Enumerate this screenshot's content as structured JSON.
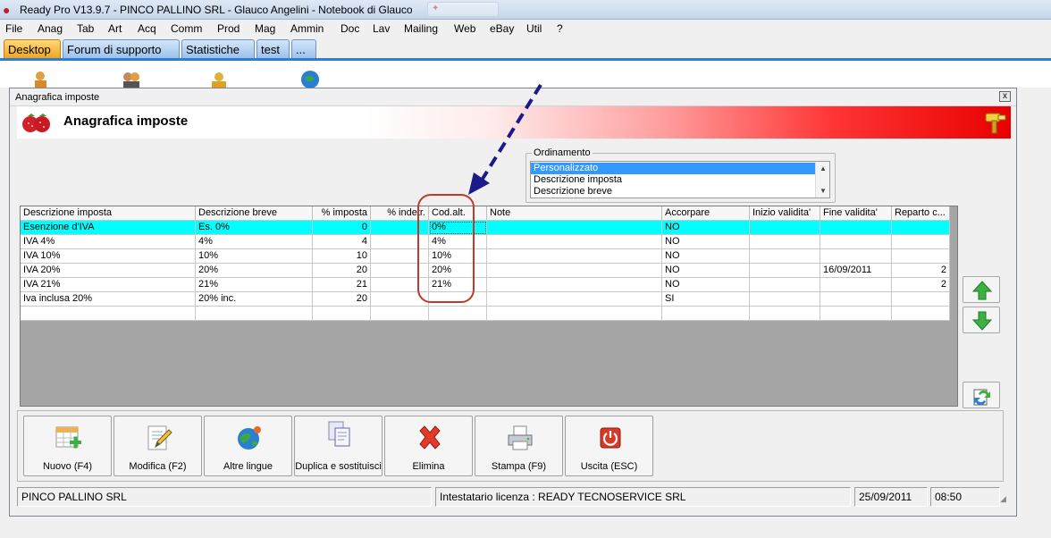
{
  "window_title": "Ready Pro V13.9.7 - PINCO PALLINO SRL - Glauco Angelini - Notebook di Glauco",
  "menu": [
    "File",
    "Anag",
    "Tab",
    "Art",
    "Acq",
    "Comm",
    "Prod",
    "Mag",
    "Ammin",
    "Doc",
    "Lav",
    "Mailing",
    "Web",
    "eBay",
    "Util",
    "?"
  ],
  "tabs": [
    "Desktop",
    "Forum di supporto",
    "Statistiche",
    "test",
    "..."
  ],
  "dialog": {
    "caption": "Anagrafica imposte",
    "heading": "Anagrafica imposte",
    "close_glyph": "x"
  },
  "ordinamento": {
    "label": "Ordinamento",
    "options": [
      "Personalizzato",
      "Descrizione imposta",
      "Descrizione breve"
    ],
    "selected": "Personalizzato"
  },
  "table": {
    "columns": [
      "Descrizione imposta",
      "Descrizione breve",
      "% imposta",
      "% indetr.",
      "Cod.alt.",
      "Note",
      "Accorpare",
      "Inizio validita'",
      "Fine validita'",
      "Reparto c..."
    ],
    "rows": [
      {
        "descrizione": "Esenzione d'IVA",
        "breve": "Es. 0%",
        "imposta": "0",
        "indetr": "",
        "codalt": "0%",
        "note": "",
        "accorpare": "NO",
        "inizio": "",
        "fine": "",
        "reparto": ""
      },
      {
        "descrizione": "IVA 4%",
        "breve": "4%",
        "imposta": "4",
        "indetr": "",
        "codalt": "4%",
        "note": "",
        "accorpare": "NO",
        "inizio": "",
        "fine": "",
        "reparto": ""
      },
      {
        "descrizione": "IVA 10%",
        "breve": "10%",
        "imposta": "10",
        "indetr": "",
        "codalt": "10%",
        "note": "",
        "accorpare": "NO",
        "inizio": "",
        "fine": "",
        "reparto": ""
      },
      {
        "descrizione": "IVA 20%",
        "breve": "20%",
        "imposta": "20",
        "indetr": "",
        "codalt": "20%",
        "note": "",
        "accorpare": "NO",
        "inizio": "",
        "fine": "16/09/2011",
        "reparto": "2"
      },
      {
        "descrizione": "IVA 21%",
        "breve": "21%",
        "imposta": "21",
        "indetr": "",
        "codalt": "21%",
        "note": "",
        "accorpare": "NO",
        "inizio": "",
        "fine": "",
        "reparto": "2"
      },
      {
        "descrizione": "Iva inclusa 20%",
        "breve": "20% inc.",
        "imposta": "20",
        "indetr": "",
        "codalt": "",
        "note": "",
        "accorpare": "SI",
        "inizio": "",
        "fine": "",
        "reparto": ""
      }
    ]
  },
  "toolbar": [
    {
      "label": "Nuovo (F4)",
      "icon": "new-grid-icon"
    },
    {
      "label": "Modifica (F2)",
      "icon": "edit-pencil-icon"
    },
    {
      "label": "Altre lingue",
      "icon": "globe-icon"
    },
    {
      "label": "Duplica e sostituisci",
      "icon": "duplicate-icon"
    },
    {
      "label": "Elimina",
      "icon": "delete-x-icon"
    },
    {
      "label": "Stampa (F9)",
      "icon": "printer-icon"
    },
    {
      "label": "Uscita (ESC)",
      "icon": "power-icon"
    }
  ],
  "side_buttons": [
    "arrow-up-icon",
    "arrow-down-icon",
    "refresh-icon"
  ],
  "status": {
    "company": "PINCO PALLINO SRL",
    "license": "Intestatario licenza : READY TECNOSERVICE SRL",
    "date": "25/09/2011",
    "time": "08:50"
  },
  "colors": {
    "selected_row": "#00ffff",
    "annotation_red": "#c0392b",
    "annotation_arrow": "#1a1a8c",
    "banner_red": "#e80000",
    "active_tab": "#f2a51e"
  }
}
